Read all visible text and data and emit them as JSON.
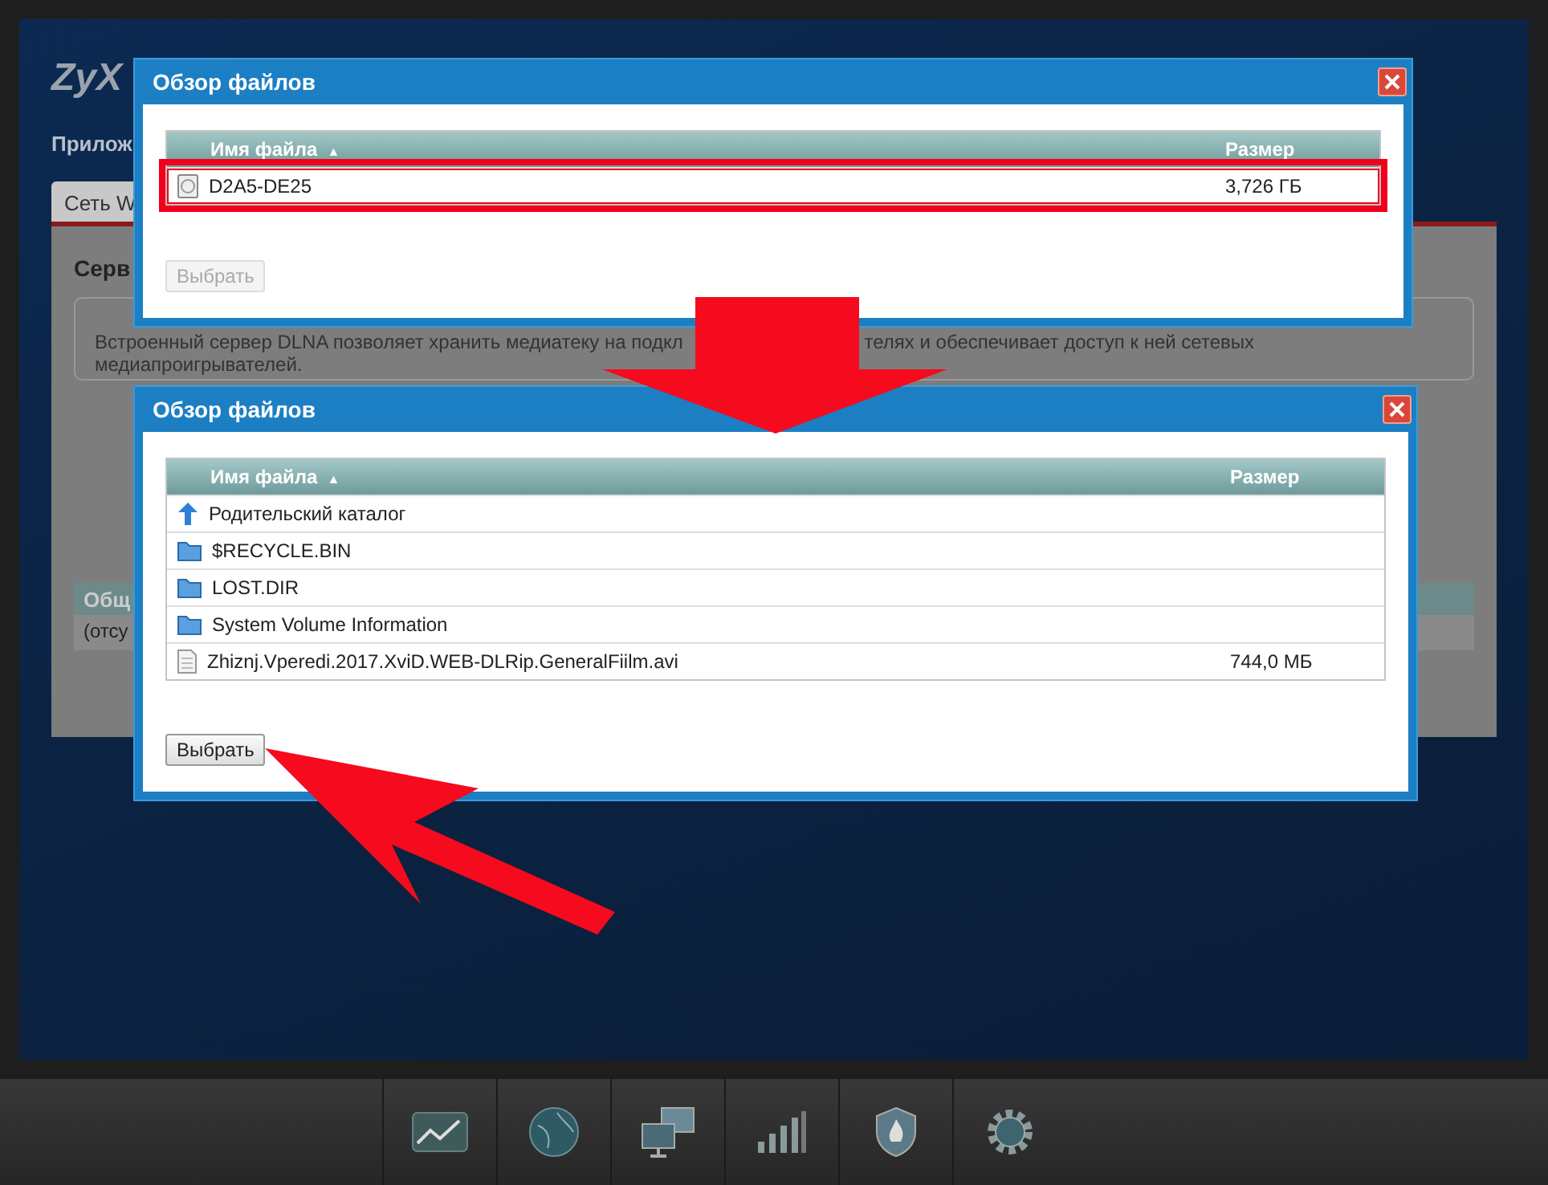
{
  "page": {
    "logo": "ZyX",
    "section_title": "Прилож",
    "tabs": [
      {
        "label": "Сеть W",
        "selected": true
      }
    ],
    "heading": "Серв",
    "description": {
      "line_1_start": "Встроенный сервер DLNA позволяет хранить медиатеку на подкл",
      "line_1_end": "телях и обеспечивает доступ к ней сетевых",
      "line_2": "медиапроигрывателей."
    },
    "table": {
      "header": "Общ",
      "cell": "(отсу"
    }
  },
  "dialogs": [
    {
      "title": "Обзор файлов",
      "columns": {
        "name": "Имя файла",
        "sort_mark": "▲",
        "size": "Размер"
      },
      "highlighted": true,
      "rows": [
        {
          "kind": "drive",
          "name": "D2A5-DE25",
          "size": "3,726 ГБ"
        }
      ],
      "button": {
        "label": "Выбрать",
        "disabled": true
      }
    },
    {
      "title": "Обзор файлов",
      "columns": {
        "name": "Имя файла",
        "sort_mark": "▲",
        "size": "Размер"
      },
      "highlighted": false,
      "rows": [
        {
          "kind": "parent",
          "name": "Родительский каталог"
        },
        {
          "kind": "folder",
          "name": "$RECYCLE.BIN"
        },
        {
          "kind": "folder",
          "name": "LOST.DIR"
        },
        {
          "kind": "folder",
          "name": "System Volume Information"
        },
        {
          "kind": "file",
          "name": "Zhiznj.Vperedi.2017.XviD.WEB-DLRip.GeneralFiilm.avi",
          "size": "744,0 МБ"
        }
      ],
      "button": {
        "label": "Выбрать",
        "disabled": false
      }
    }
  ]
}
